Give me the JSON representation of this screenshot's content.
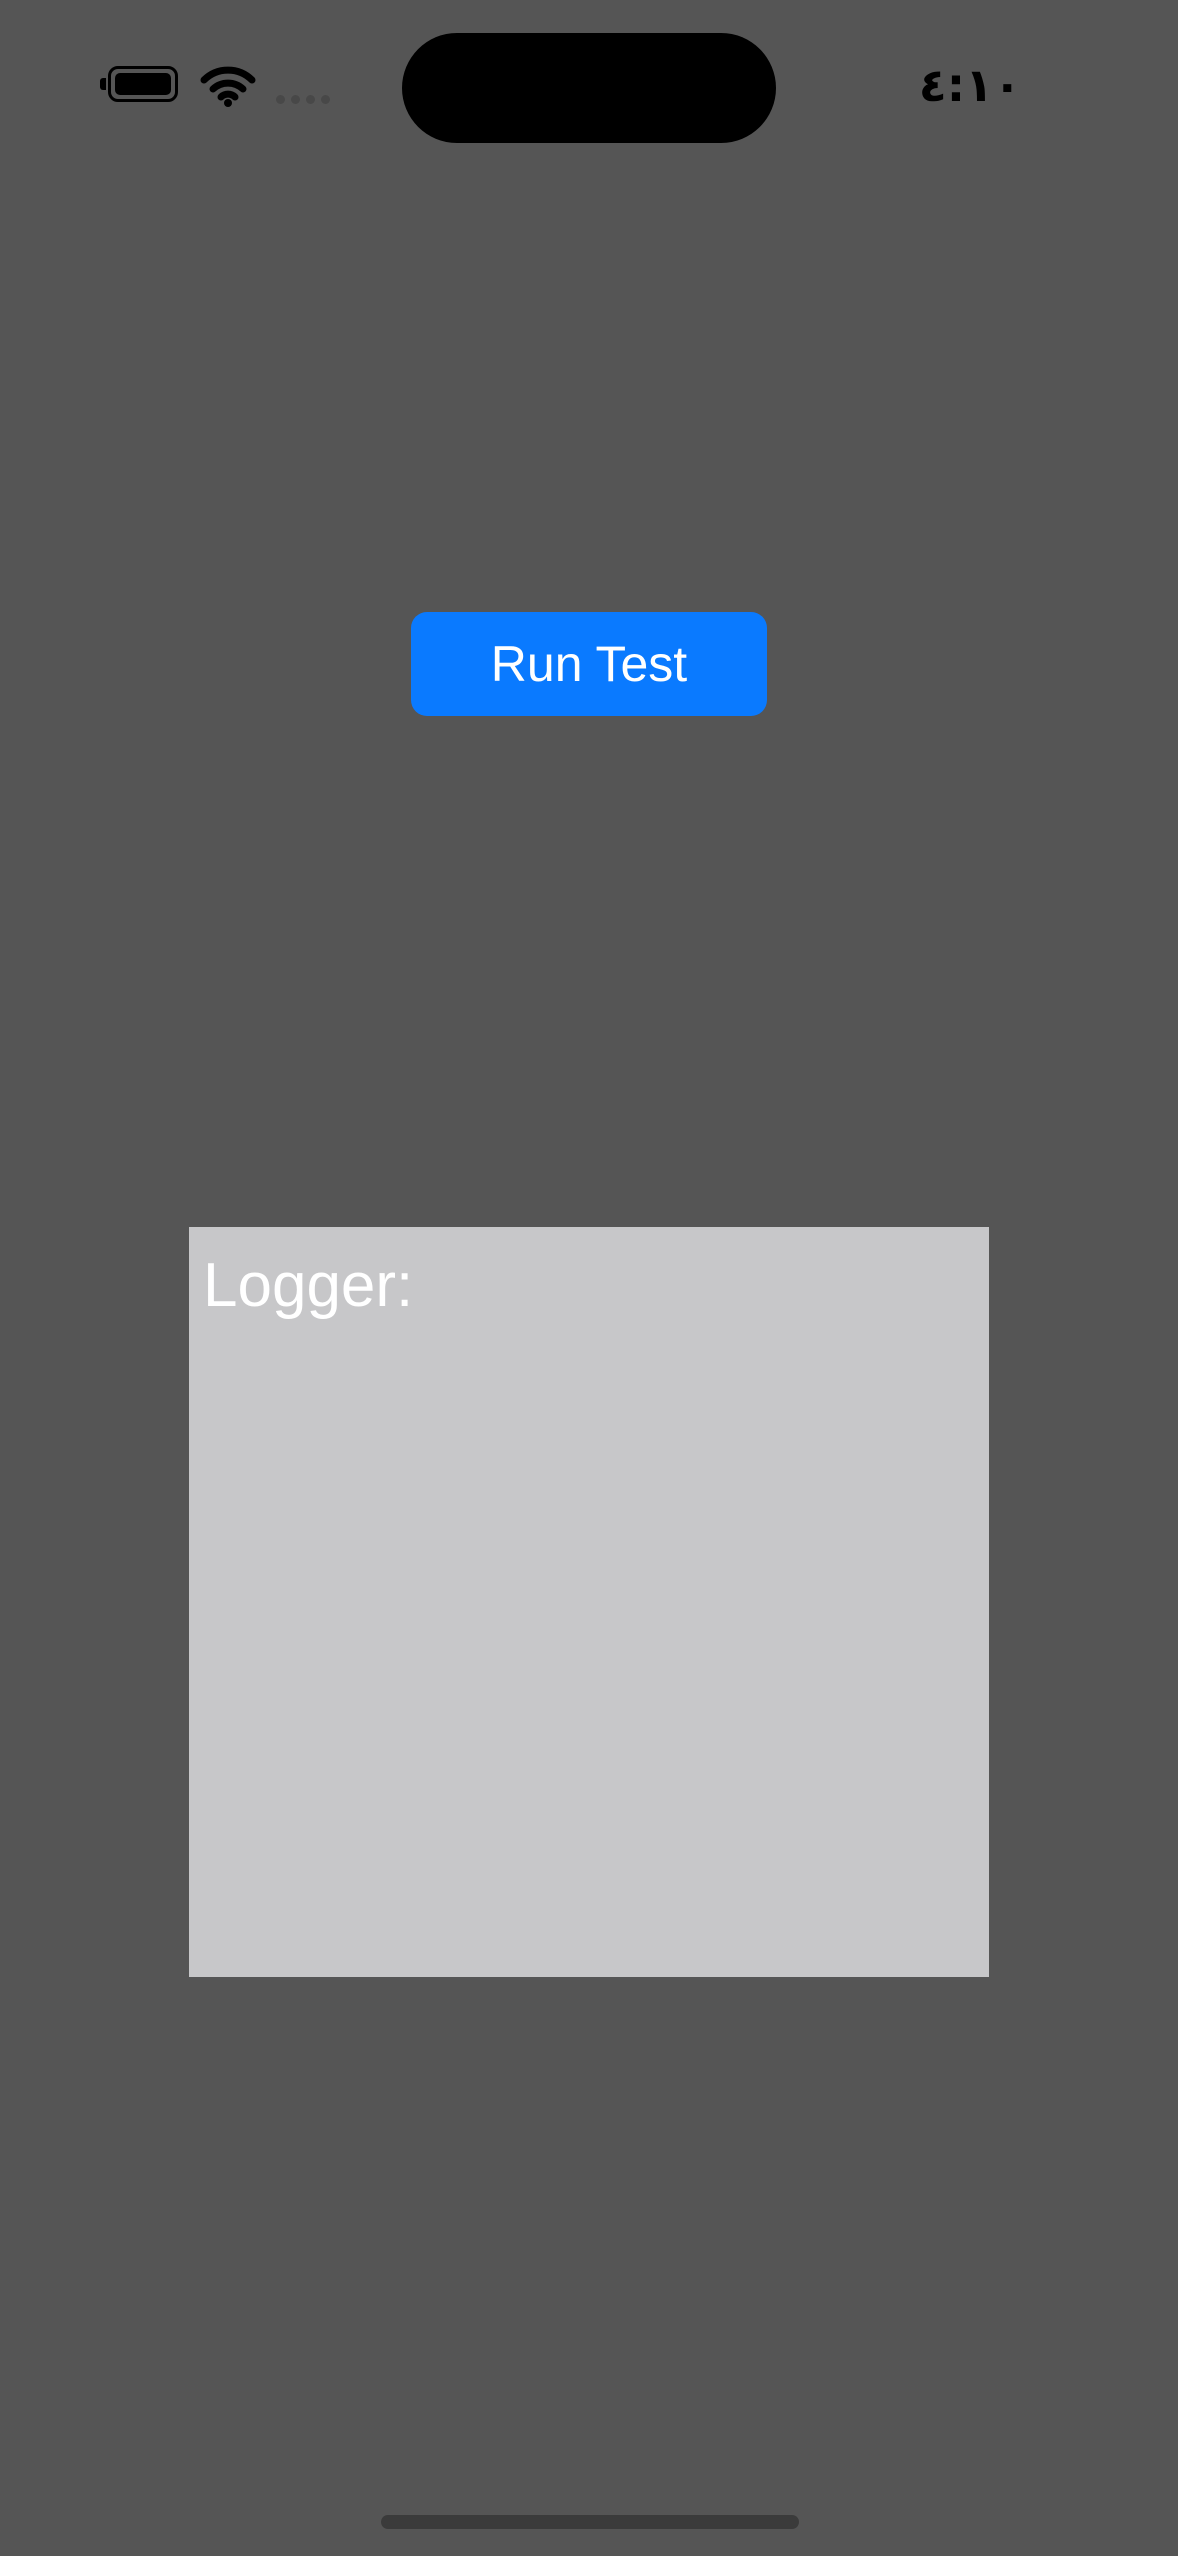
{
  "status_bar": {
    "time": "٤:١٠",
    "battery_icon": "battery-icon",
    "wifi_icon": "wifi-icon",
    "signal_icon": "cellular-signal-icon"
  },
  "main": {
    "run_button_label": "Run Test",
    "logger_label": "Logger:"
  },
  "colors": {
    "background": "#555555",
    "button": "#0a7aff",
    "logger_background": "#c7c7c9"
  }
}
